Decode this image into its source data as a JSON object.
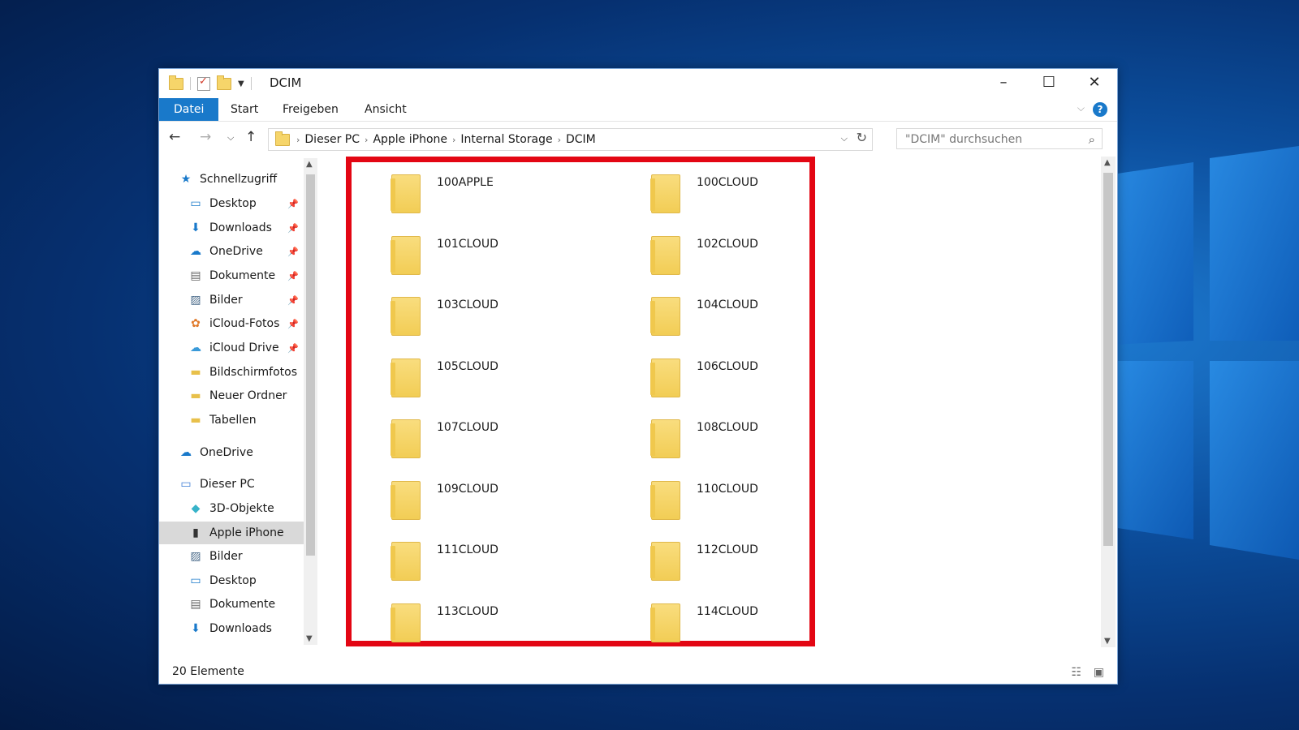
{
  "window": {
    "title": "DCIM"
  },
  "ribbon": {
    "tabs": [
      "Datei",
      "Start",
      "Freigeben",
      "Ansicht"
    ]
  },
  "address": {
    "crumbs": [
      "Dieser PC",
      "Apple iPhone",
      "Internal Storage",
      "DCIM"
    ]
  },
  "search": {
    "placeholder": "\"DCIM\" durchsuchen"
  },
  "sidebar": {
    "items": [
      {
        "label": "Schnellzugriff",
        "icon": "star-icon",
        "pinned": false,
        "selected": false
      },
      {
        "label": "Desktop",
        "icon": "desktop-icon",
        "pinned": true,
        "selected": false
      },
      {
        "label": "Downloads",
        "icon": "download-icon",
        "pinned": true,
        "selected": false
      },
      {
        "label": "OneDrive",
        "icon": "cloud-icon",
        "pinned": true,
        "selected": false
      },
      {
        "label": "Dokumente",
        "icon": "document-icon",
        "pinned": true,
        "selected": false
      },
      {
        "label": "Bilder",
        "icon": "pictures-icon",
        "pinned": true,
        "selected": false
      },
      {
        "label": "iCloud-Fotos",
        "icon": "photos-icon",
        "pinned": true,
        "selected": false
      },
      {
        "label": "iCloud Drive",
        "icon": "icloud-icon",
        "pinned": true,
        "selected": false
      },
      {
        "label": "Bildschirmfotos",
        "icon": "folder-icon",
        "pinned": false,
        "selected": false
      },
      {
        "label": "Neuer Ordner",
        "icon": "folder-icon",
        "pinned": false,
        "selected": false
      },
      {
        "label": "Tabellen",
        "icon": "folder-icon",
        "pinned": false,
        "selected": false
      },
      {
        "label": "OneDrive",
        "icon": "cloud-icon",
        "pinned": false,
        "selected": false
      },
      {
        "label": "Dieser PC",
        "icon": "computer-icon",
        "pinned": false,
        "selected": false
      },
      {
        "label": "3D-Objekte",
        "icon": "cube-icon",
        "pinned": false,
        "selected": false
      },
      {
        "label": "Apple iPhone",
        "icon": "phone-icon",
        "pinned": false,
        "selected": true
      },
      {
        "label": "Bilder",
        "icon": "pictures-icon",
        "pinned": false,
        "selected": false
      },
      {
        "label": "Desktop",
        "icon": "desktop-icon",
        "pinned": false,
        "selected": false
      },
      {
        "label": "Dokumente",
        "icon": "document-icon",
        "pinned": false,
        "selected": false
      },
      {
        "label": "Downloads",
        "icon": "download-icon",
        "pinned": false,
        "selected": false
      }
    ]
  },
  "folders": [
    "100APPLE",
    "100CLOUD",
    "101CLOUD",
    "102CLOUD",
    "103CLOUD",
    "104CLOUD",
    "105CLOUD",
    "106CLOUD",
    "107CLOUD",
    "108CLOUD",
    "109CLOUD",
    "110CLOUD",
    "111CLOUD",
    "112CLOUD",
    "113CLOUD",
    "114CLOUD"
  ],
  "status": {
    "count": "20 Elemente"
  },
  "colors": {
    "accent": "#1979ca",
    "highlight": "#e30613"
  }
}
